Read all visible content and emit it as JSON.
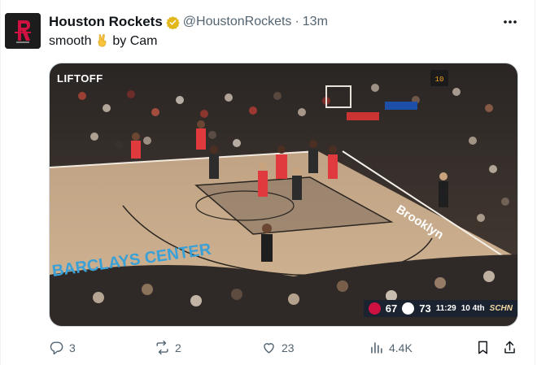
{
  "tweet": {
    "display_name": "Houston Rockets",
    "handle": "@HoustonRockets",
    "separator": "·",
    "time": "13m",
    "text": "smooth",
    "text_suffix": "by Cam",
    "avatar_icon": "houston-rockets-logo-icon",
    "verified_icon": "verified-badge-icon"
  },
  "media": {
    "watermark": "LIFTOFF",
    "court_text": "BARCLAYS CENTER",
    "baseline_text": "Brooklyn",
    "scorebug": {
      "home_score": "67",
      "away_score": "73",
      "clock": "11:29",
      "period": "10 4th",
      "network": "SCHN",
      "home_color": "#ce1141",
      "away_color": "#ffffff"
    }
  },
  "actions": {
    "reply_count": "3",
    "repost_count": "2",
    "like_count": "23",
    "view_count": "4.4K"
  },
  "colors": {
    "verified_gold": "#e2b719",
    "rockets_red": "#ce1141",
    "muted": "#536471"
  }
}
